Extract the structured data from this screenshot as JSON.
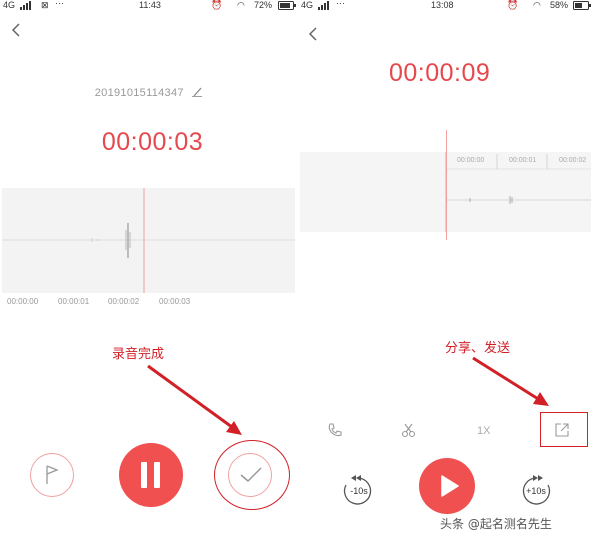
{
  "left": {
    "status": {
      "signal": "4G",
      "time": "11:43",
      "battery": "72%"
    },
    "file_name": "20191015114347",
    "timer": "00:00:03",
    "ticks": [
      "00:00:00",
      "00:00:01",
      "00:00:02",
      "00:00:03"
    ],
    "annotation": "录音完成",
    "icons": {
      "back": "back-chevron-icon",
      "edit": "pencil-icon",
      "flag": "flag-icon",
      "pause": "pause-icon",
      "done": "checkmark-icon"
    }
  },
  "right": {
    "status": {
      "signal": "4G",
      "time": "13:08",
      "battery": "58%"
    },
    "timer": "00:00:09",
    "ticks": [
      "00:00:00",
      "00:00:01",
      "00:00:02"
    ],
    "annotation": "分享、发送",
    "speed_label": "1X",
    "rewind_label": "-10s",
    "forward_label": "+10s",
    "icons": {
      "back": "back-chevron-icon",
      "phone": "phone-icon",
      "cut": "scissors-icon",
      "share": "share-icon",
      "play": "play-icon"
    }
  },
  "watermark": "头条 @起名测名先生",
  "colors": {
    "accent": "#f05050",
    "annotation": "#d22027"
  }
}
